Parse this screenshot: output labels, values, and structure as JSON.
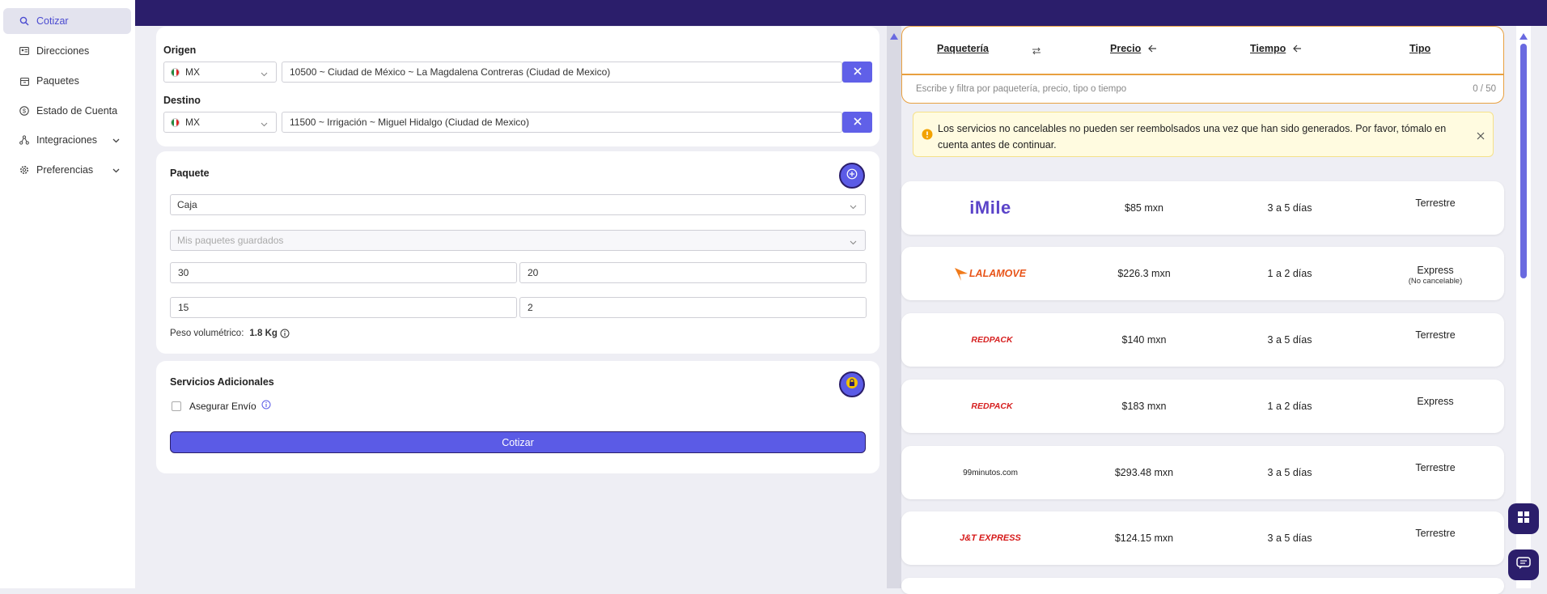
{
  "sidebar": {
    "items": [
      {
        "label": "Cotizar",
        "icon": "search-icon"
      },
      {
        "label": "Direcciones",
        "icon": "address-card-icon"
      },
      {
        "label": "Paquetes",
        "icon": "package-icon"
      },
      {
        "label": "Estado de Cuenta",
        "icon": "dollar-icon"
      },
      {
        "label": "Integraciones",
        "icon": "network-icon"
      },
      {
        "label": "Preferencias",
        "icon": "gear-icon"
      }
    ]
  },
  "origin": {
    "label": "Origen",
    "country": "MX",
    "address": "10500 ~ Ciudad de México ~ La Magdalena Contreras (Ciudad de Mexico)"
  },
  "destination": {
    "label": "Destino",
    "country": "MX",
    "address": "11500 ~ Irrigación ~ Miguel Hidalgo (Ciudad de Mexico)"
  },
  "package": {
    "title": "Paquete",
    "type": "Caja",
    "saved_placeholder": "Mis paquetes guardados",
    "length": "30",
    "width": "20",
    "height": "15",
    "weight": "2",
    "volumetric_label": "Peso volumétrico:",
    "volumetric_value": "1.8 Kg"
  },
  "services": {
    "title": "Servicios Adicionales",
    "insure_label": "Asegurar Envío",
    "quote_button": "Cotizar"
  },
  "results": {
    "headers": {
      "carrier": "Paquetería",
      "price": "Precio",
      "time": "Tiempo",
      "type": "Tipo"
    },
    "filter_placeholder": "Escribe y filtra por paquetería, precio, tipo o tiempo",
    "filter_count": "0 / 50",
    "warning": "Los servicios no cancelables no pueden ser reembolsados una vez que han sido generados. Por favor, tómalo en cuenta antes de continuar.",
    "rows": [
      {
        "carrier": "iMile",
        "price": "$85 mxn",
        "time": "3 a 5 días",
        "type": "Terrestre",
        "note": ""
      },
      {
        "carrier": "LALAMOVE",
        "price": "$226.3 mxn",
        "time": "1 a 2 días",
        "type": "Express",
        "note": "(No cancelable)"
      },
      {
        "carrier": "REDPACK",
        "price": "$140 mxn",
        "time": "3 a 5 días",
        "type": "Terrestre",
        "note": ""
      },
      {
        "carrier": "REDPACK",
        "price": "$183 mxn",
        "time": "1 a 2 días",
        "type": "Express",
        "note": ""
      },
      {
        "carrier": "99minutos.com",
        "price": "$293.48 mxn",
        "time": "3 a 5 días",
        "type": "Terrestre",
        "note": ""
      },
      {
        "carrier": "J&T EXPRESS",
        "price": "$124.15 mxn",
        "time": "3 a 5 días",
        "type": "Terrestre",
        "note": ""
      }
    ]
  },
  "colors": {
    "primary": "#5b5be6",
    "dark": "#2b1e6b",
    "warning_bg": "#fffbe0",
    "warning_border": "#f5e18a"
  }
}
